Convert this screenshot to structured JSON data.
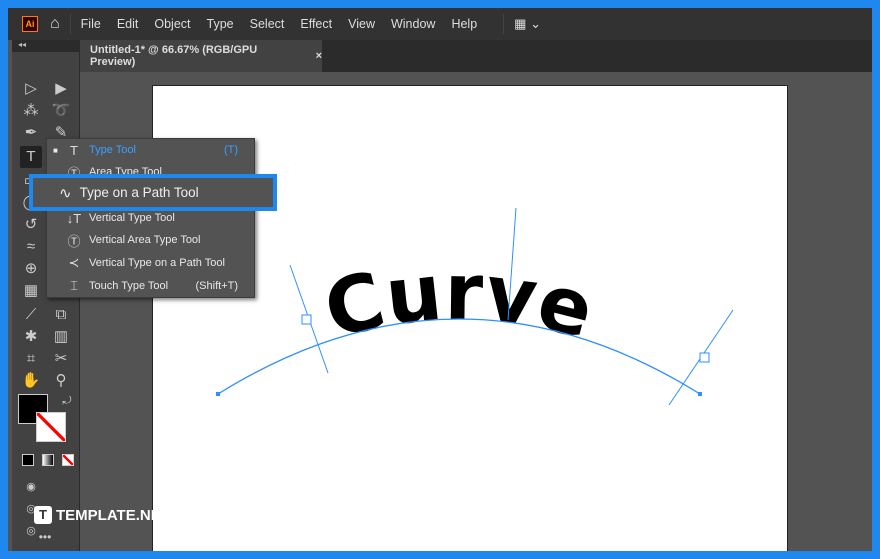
{
  "menubar": {
    "logo": "Ai",
    "items": [
      "File",
      "Edit",
      "Object",
      "Type",
      "Select",
      "Effect",
      "View",
      "Window",
      "Help"
    ]
  },
  "tab": {
    "title": "Untitled-1* @ 66.67% (RGB/GPU Preview)",
    "close": "×"
  },
  "flyout": {
    "items": [
      {
        "label": "Type Tool",
        "shortcut": "(T)",
        "icon": "T"
      },
      {
        "label": "Area Type Tool",
        "shortcut": "",
        "icon": "T"
      },
      {
        "label": "Type on a Path Tool",
        "shortcut": "",
        "icon": "~"
      },
      {
        "label": "Vertical Type Tool",
        "shortcut": "",
        "icon": "↓T"
      },
      {
        "label": "Vertical Area Type Tool",
        "shortcut": "",
        "icon": "T"
      },
      {
        "label": "Vertical Type on a Path Tool",
        "shortcut": "",
        "icon": "~"
      },
      {
        "label": "Touch Type Tool",
        "shortcut": "(Shift+T)",
        "icon": "T"
      }
    ]
  },
  "canvas": {
    "text": "Curve"
  },
  "watermark": "TEMPLATE.NET",
  "colors": {
    "accent": "#1e88ee",
    "path": "#2f8fff"
  }
}
